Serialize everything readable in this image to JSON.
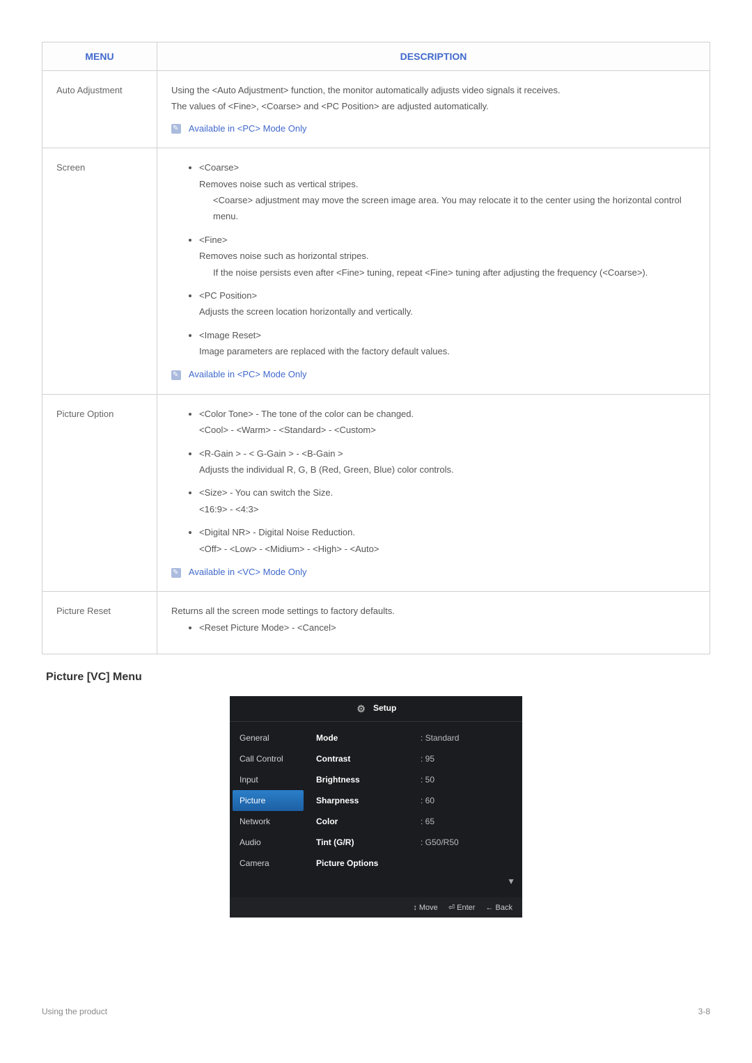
{
  "table": {
    "headers": {
      "menu": "MENU",
      "description": "DESCRIPTION"
    },
    "rows": {
      "auto_adjustment": {
        "menu": "Auto Adjustment",
        "line1": "Using the <Auto Adjustment> function, the monitor automatically adjusts video signals it receives.",
        "line2": "The values of <Fine>, <Coarse> and <PC Position> are adjusted automatically.",
        "note": "Available in <PC> Mode Only"
      },
      "screen": {
        "menu": "Screen",
        "coarse_title": "<Coarse>",
        "coarse_desc": "Removes noise such as vertical stripes.",
        "coarse_sub": "<Coarse> adjustment may move the screen image area. You may relocate it to the center using the horizontal control menu.",
        "fine_title": "<Fine>",
        "fine_desc": "Removes noise such as horizontal stripes.",
        "fine_sub": "If the noise persists even after <Fine> tuning, repeat <Fine> tuning after adjusting the frequency (<Coarse>).",
        "pcpos_title": "<PC Position>",
        "pcpos_desc": "Adjusts the screen location horizontally and vertically.",
        "imgreset_title": "<Image Reset>",
        "imgreset_desc": "Image parameters are replaced with the factory default values.",
        "note": "Available in <PC> Mode Only"
      },
      "picture_option": {
        "menu": "Picture Option",
        "color_tone": "<Color Tone> - The tone of the color can be changed.",
        "color_tone_opts": "<Cool> - <Warm> - <Standard> - <Custom>",
        "gain_title": "<R-Gain > - < G-Gain > - <B-Gain >",
        "gain_desc": "Adjusts the individual R, G, B (Red, Green, Blue) color controls.",
        "size_title": "<Size> - You can switch the Size.",
        "size_opts": "<16:9> - <4:3>",
        "nr_title": "<Digital NR> - Digital Noise Reduction.",
        "nr_opts": "<Off> - <Low> - <Midium> - <High> - <Auto>",
        "note": "Available in <VC> Mode Only"
      },
      "picture_reset": {
        "menu": "Picture Reset",
        "desc": "Returns all the screen mode settings to factory defaults.",
        "bullet": "<Reset Picture Mode> - <Cancel>"
      }
    }
  },
  "section_title": "Picture [VC] Menu",
  "osd": {
    "title": "Setup",
    "sidebar": [
      "General",
      "Call Control",
      "Input",
      "Picture",
      "Network",
      "Audio",
      "Camera"
    ],
    "items": {
      "Mode": ": Standard",
      "Contrast": ": 95",
      "Brightness": ": 50",
      "Sharpness": ": 60",
      "Color": ": 65",
      "Tint (G/R)": ": G50/R50",
      "Picture Options": ""
    },
    "arrow_down": "▼",
    "footer": {
      "move": "↕ Move",
      "enter": "⏎ Enter",
      "back": "← Back"
    }
  },
  "footer": {
    "left": "Using the product",
    "right": "3-8"
  }
}
